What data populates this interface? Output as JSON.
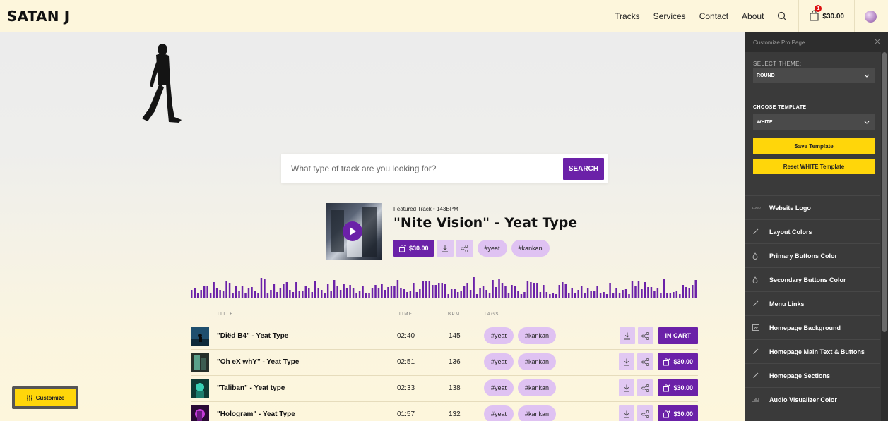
{
  "brand": "SATAN J",
  "nav": {
    "links": [
      "Tracks",
      "Services",
      "Contact",
      "About"
    ],
    "cart_count": "1",
    "cart_total": "$30.00"
  },
  "search": {
    "placeholder": "What type of track are you looking for?",
    "button": "SEARCH"
  },
  "featured": {
    "meta": "Featured Track • 143BPM",
    "title": "\"Nite Vision\" - Yeat Type",
    "price": "$30.00",
    "tags": [
      "#yeat",
      "#kankan"
    ]
  },
  "table": {
    "headers": {
      "title": "TITLE",
      "time": "TIME",
      "bpm": "BPM",
      "tags": "TAGS"
    },
    "rows": [
      {
        "title": "\"Diëd B4\" - Yeat Type",
        "time": "02:40",
        "bpm": "145",
        "tags": [
          "#yeat",
          "#kankan"
        ],
        "action": "IN CART",
        "in_cart": true
      },
      {
        "title": "\"Oh eX whY\" - Yeat Type",
        "time": "02:51",
        "bpm": "136",
        "tags": [
          "#yeat",
          "#kankan"
        ],
        "action": "$30.00",
        "in_cart": false
      },
      {
        "title": "\"Taliban\" - Yeat type",
        "time": "02:33",
        "bpm": "138",
        "tags": [
          "#yeat",
          "#kankan"
        ],
        "action": "$30.00",
        "in_cart": false
      },
      {
        "title": "\"Hologram\" - Yeat Type",
        "time": "01:57",
        "bpm": "132",
        "tags": [
          "#yeat",
          "#kankan"
        ],
        "action": "$30.00",
        "in_cart": false
      }
    ]
  },
  "customize_button": "Customize",
  "panel": {
    "header": "Customize Pro Page",
    "theme_label": "SELECT THEME:",
    "theme_value": "ROUND",
    "template_label": "CHOOSE TEMPLATE",
    "template_value": "WHITE",
    "save_button": "Save Template",
    "reset_button": "Reset WHITE Template",
    "logo_icon_text": "LOGO",
    "items": [
      {
        "label": "Website Logo",
        "icon": "logo-text-icon"
      },
      {
        "label": "Layout Colors",
        "icon": "brush-icon"
      },
      {
        "label": "Primary Buttons Color",
        "icon": "droplet-icon"
      },
      {
        "label": "Secondary Buttons Color",
        "icon": "droplet-icon"
      },
      {
        "label": "Menu Links",
        "icon": "brush-icon"
      },
      {
        "label": "Homepage Background",
        "icon": "image-icon"
      },
      {
        "label": "Homepage Main Text & Buttons",
        "icon": "brush-icon"
      },
      {
        "label": "Homepage Sections",
        "icon": "brush-icon"
      },
      {
        "label": "Audio Visualizer Color",
        "icon": "bars-icon"
      }
    ]
  },
  "colors": {
    "accent": "#6b21a8",
    "tag_bg": "#dfc2f2",
    "page_bg": "#fdf6dc",
    "panel_bg": "#3a3a3a",
    "yellow": "#ffd60a"
  }
}
